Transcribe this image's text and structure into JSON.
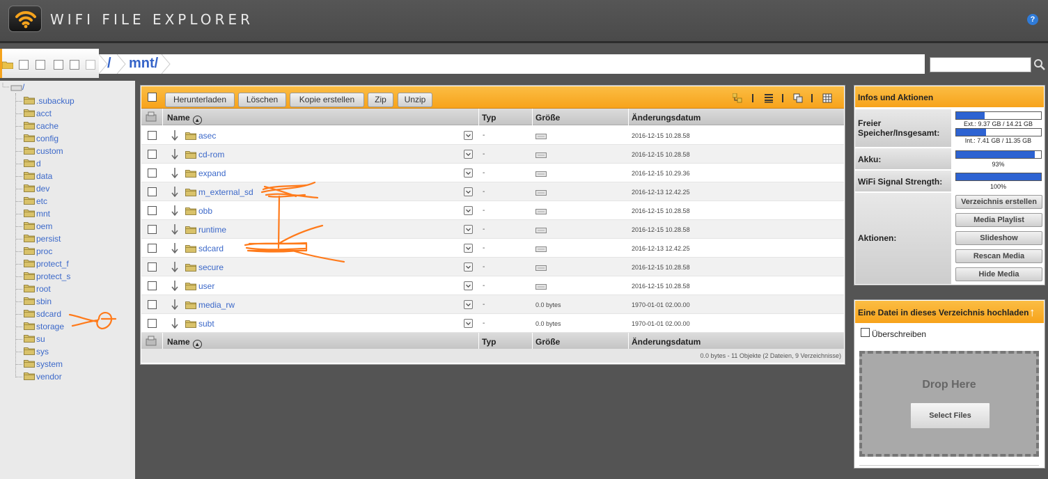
{
  "app": {
    "title": "WIFI FILE EXPLORER",
    "help_label": "?"
  },
  "breadcrumb": {
    "root": "/",
    "current": "mnt/"
  },
  "search": {
    "placeholder": ""
  },
  "sidebar": {
    "root_label": "/",
    "items": [
      ".subackup",
      "acct",
      "cache",
      "config",
      "custom",
      "d",
      "data",
      "dev",
      "etc",
      "mnt",
      "oem",
      "persist",
      "proc",
      "protect_f",
      "protect_s",
      "root",
      "sbin",
      "sdcard",
      "storage",
      "su",
      "sys",
      "system",
      "vendor"
    ]
  },
  "toolbar": {
    "download": "Herunterladen",
    "delete": "Löschen",
    "copy": "Kopie erstellen",
    "zip": "Zip",
    "unzip": "Unzip"
  },
  "columns": {
    "name": "Name",
    "type": "Typ",
    "size": "Größe",
    "date": "Änderungsdatum"
  },
  "files": [
    {
      "name": "asec",
      "type": "-",
      "size": "",
      "date": "2016-12-15 10.28.58"
    },
    {
      "name": "cd-rom",
      "type": "-",
      "size": "",
      "date": "2016-12-15 10.28.58"
    },
    {
      "name": "expand",
      "type": "-",
      "size": "",
      "date": "2016-12-15 10.29.36"
    },
    {
      "name": "m_external_sd",
      "type": "-",
      "size": "",
      "date": "2016-12-13 12.42.25"
    },
    {
      "name": "obb",
      "type": "-",
      "size": "",
      "date": "2016-12-15 10.28.58"
    },
    {
      "name": "runtime",
      "type": "-",
      "size": "",
      "date": "2016-12-15 10.28.58"
    },
    {
      "name": "sdcard",
      "type": "-",
      "size": "",
      "date": "2016-12-13 12.42.25"
    },
    {
      "name": "secure",
      "type": "-",
      "size": "",
      "date": "2016-12-15 10.28.58"
    },
    {
      "name": "user",
      "type": "-",
      "size": "",
      "date": "2016-12-15 10.28.58"
    },
    {
      "name": "media_rw",
      "type": "-",
      "size": "0.0 bytes",
      "date": "1970-01-01 02.00.00"
    },
    {
      "name": "subt",
      "type": "-",
      "size": "0.0 bytes",
      "date": "1970-01-01 02.00.00"
    }
  ],
  "status": "0.0 bytes - 11 Objekte (2 Dateien, 9 Verzeichnisse)",
  "info": {
    "title": "Infos und Aktionen",
    "storage_label": "Freier Speicher/Insgesamt:",
    "ext_text": "Ext.: 9.37 GB / 14.21 GB",
    "ext_fill": 0.34,
    "int_text": "Int.: 7.41 GB / 11.35 GB",
    "int_fill": 0.35,
    "battery_label": "Akku:",
    "battery_text": "93%",
    "battery_fill": 0.93,
    "wifi_label": "WiFi Signal Strength:",
    "wifi_text": "100%",
    "wifi_fill": 1.0,
    "actions_label": "Aktionen:",
    "actions": [
      "Verzeichnis erstellen",
      "Media Playlist",
      "Slideshow",
      "Rescan Media",
      "Hide Media"
    ]
  },
  "upload": {
    "title": "Eine Datei in dieses Verzeichnis hochladen",
    "overwrite_label": "Überschreiben",
    "drop_here": "Drop Here",
    "select_files": "Select Files"
  },
  "colors": {
    "accent": "#f7a31b",
    "link": "#3b68c9",
    "annotation": "#ff7a1a"
  }
}
